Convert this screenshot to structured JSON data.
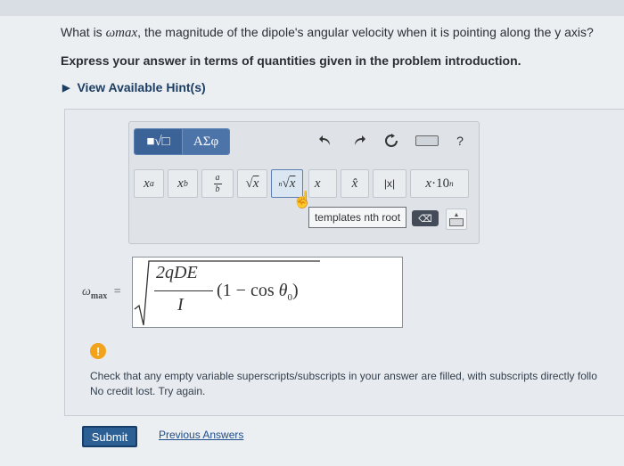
{
  "question": {
    "prefix": "What is",
    "symbol": "ωmax",
    "suffix": ", the magnitude of the dipole's angular velocity when it is pointing along the y axis?"
  },
  "instruction": "Express your answer in terms of quantities given in the problem introduction.",
  "hints_label": "View Available Hint(s)",
  "toolbar": {
    "templates_label": "■√□",
    "greek_label": "ΑΣφ",
    "undo_icon": "undo-icon",
    "redo_icon": "redo-icon",
    "reset_icon": "reset-icon",
    "keyboard_icon": "keyboard-icon",
    "help_label": "?",
    "buttons": [
      "xª",
      "x_b",
      "a/b",
      "√x",
      "ⁿ√x",
      "x⃗",
      "x̂",
      "|x|",
      "x·10ⁿ"
    ],
    "tooltip": "templates nth root"
  },
  "answer": {
    "variable": "ω",
    "variable_sub": "max",
    "equals": "=",
    "numerator": "2qDE",
    "denominator": "I",
    "paren_expression_open": "(1 − cos ",
    "theta": "θ",
    "theta_sub": "0",
    "paren_close": ")"
  },
  "feedback": {
    "icon": "!",
    "line1": "Check that any empty variable superscripts/subscripts in your answer are filled, with subscripts directly follo",
    "line2": "No credit lost. Try again."
  },
  "submit_label": "Submit",
  "previous_answers_label": "Previous Answers",
  "colors": {
    "accent": "#2c5f94",
    "warning": "#f2a31b",
    "template_blue": "#4d74a8"
  }
}
